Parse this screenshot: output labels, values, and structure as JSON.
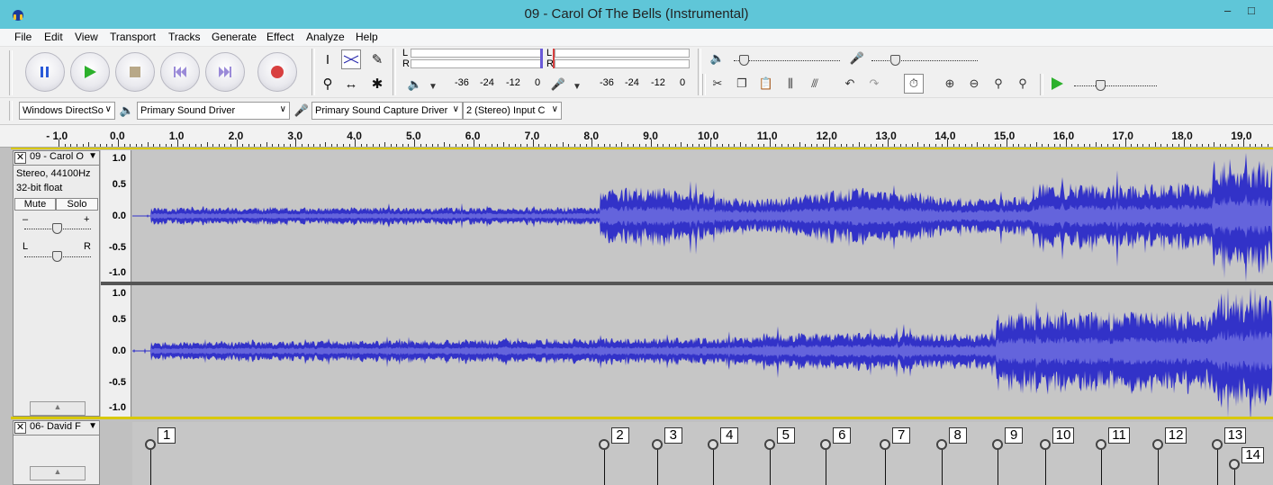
{
  "window": {
    "title": "09 - Carol Of The Bells (Instrumental)",
    "minimize": "–",
    "maximize": "□"
  },
  "menu": [
    "File",
    "Edit",
    "View",
    "Transport",
    "Tracks",
    "Generate",
    "Effect",
    "Analyze",
    "Help"
  ],
  "transport": {
    "pause": "pause-icon",
    "play": "play-icon",
    "stop": "stop-icon",
    "skip_start": "skip-to-start-icon",
    "skip_end": "skip-to-end-icon",
    "record": "record-icon"
  },
  "meters": {
    "play_l": "L",
    "play_r": "R",
    "rec_l": "L",
    "rec_r": "R",
    "play_scale": [
      "-36",
      "-24",
      "-12",
      "0"
    ],
    "rec_scale": [
      "-36",
      "-24",
      "-12",
      "0"
    ]
  },
  "devices": {
    "host": "Windows DirectSo",
    "playback": "Primary Sound Driver",
    "recording": "Primary Sound Capture Driver",
    "channels": "2 (Stereo) Input C"
  },
  "ruler": {
    "labels": [
      "- 1.0",
      "0.0",
      "1.0",
      "2.0",
      "3.0",
      "4.0",
      "5.0",
      "6.0",
      "7.0",
      "8.0",
      "9.0",
      "10.0",
      "11.0",
      "12.0",
      "13.0",
      "14.0",
      "15.0",
      "16.0",
      "17.0",
      "18.0",
      "19.0"
    ]
  },
  "audio_track": {
    "name": "09 - Carol O",
    "format": "Stereo, 44100Hz",
    "bits": "32-bit float",
    "mute": "Mute",
    "solo": "Solo",
    "gain_min": "–",
    "gain_max": "+",
    "pan_left": "L",
    "pan_right": "R",
    "scale": [
      "1.0",
      "0.5",
      "0.0",
      "-0.5",
      "-1.0"
    ]
  },
  "label_track": {
    "name": "06- David F",
    "labels": [
      "1",
      "2",
      "3",
      "4",
      "5",
      "6",
      "7",
      "8",
      "9",
      "10",
      "11",
      "12",
      "13",
      "14"
    ]
  },
  "colors": {
    "waveform": "#3232c8",
    "waveform_rms": "#6464dc",
    "titlebar": "#5fc6d8",
    "record": "#d84040",
    "play": "#2cb02c"
  }
}
